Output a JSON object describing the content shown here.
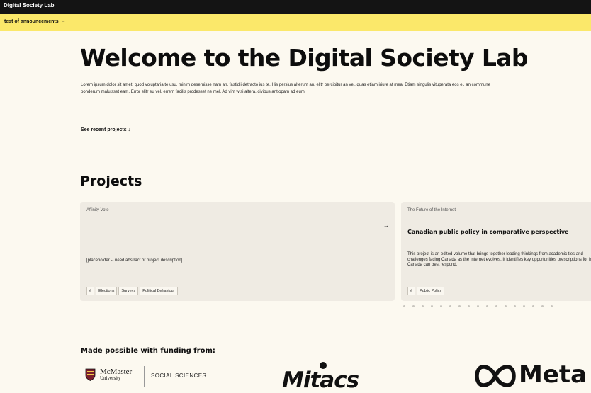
{
  "topbar": {
    "brand": "Digital Society Lab"
  },
  "announcement": {
    "text": "test of announcements",
    "arrow": "→"
  },
  "hero": {
    "title": "Welcome to the Digital Society Lab",
    "body": "Lorem ipsum dolor sit amet, quod voluptaria te usu, minim deseruisse nam an, fastidii detracto ius te. His persius alterum an, elitr percipitur an vel, quas etiam iriure at mea. Etiam singulis vituperata eos ei, an commune ponderum maluisset eam. Error elitr eu vel, errem facilis prodesset ne mel. Ad vim wisi altera, civibus antiopam ad eum.",
    "recent_link": "See recent projects",
    "recent_arrow": "↓"
  },
  "projects": {
    "title": "Projects",
    "cards": [
      {
        "kicker": "Affinity Vote",
        "heading": "",
        "description": "[placeholder -- need abstract or project description]",
        "arrow": "→",
        "tags": [
          "#",
          "Elections",
          "Surveys",
          "Political Behaviour"
        ]
      },
      {
        "kicker": "The Future of the Internet",
        "heading": "Canadian public policy in comparative perspective",
        "description": "This project is an edited volume that brings together leading thinkings from academic ties and challenges facing Canada as the Internet evolves. It identifies key opportunities prescriptions for how Canada can best respond.",
        "arrow": "",
        "tags": [
          "#",
          "Public Policy"
        ]
      }
    ],
    "carousel_dot_count": 17
  },
  "funding": {
    "title": "Made possible with funding from:",
    "logos": {
      "mcmaster_name": "McMaster",
      "mcmaster_sub": "University",
      "mcmaster_faculty": "SOCIAL SCIENCES",
      "mitacs": "Mitacs",
      "meta": "Meta"
    }
  },
  "colors": {
    "background": "#fcf9f0",
    "topbar": "#141414",
    "announcement": "#fbe86a",
    "card": "#efebe3"
  }
}
